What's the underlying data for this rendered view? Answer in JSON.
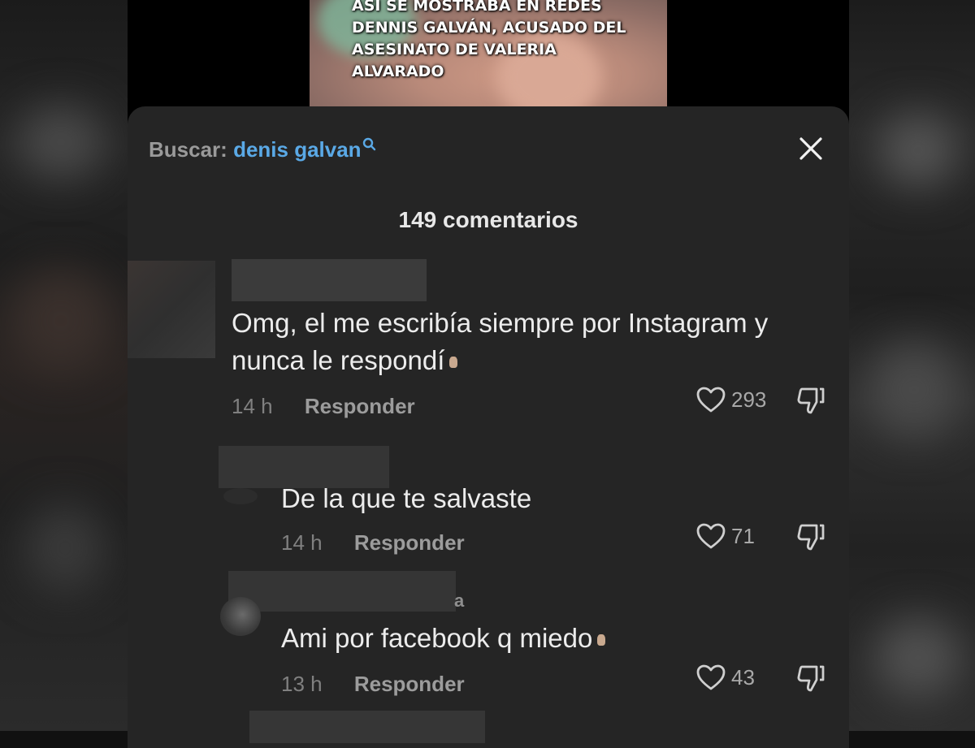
{
  "video": {
    "caption": "ASÍ SE MOSTRABA EN REDES DENNIS GALVÁN, ACUSADO DEL ASESINATO DE VALERIA ALVARADO"
  },
  "sheet": {
    "search_label": "Buscar:",
    "search_term": "denis galvan",
    "comment_count": "149 comentarios"
  },
  "comments": [
    {
      "text_line1": "Omg, el me escribía siempre por Instagram y",
      "text_line2": "nunca le respondí",
      "time": "14 h",
      "reply_label": "Responder",
      "likes": "293"
    },
    {
      "text": "De la que te salvaste",
      "time": "14 h",
      "reply_label": "Responder",
      "likes": "71"
    },
    {
      "name_suffix": "a",
      "text": "Ami por facebook q miedo",
      "time": "13 h",
      "reply_label": "Responder",
      "likes": "43"
    }
  ],
  "colors": {
    "sheet_bg": "#252525",
    "search_term": "#5aa9e6",
    "text_primary": "#ececec",
    "text_secondary": "#808080"
  },
  "icons": [
    "search-icon",
    "close-icon",
    "heart-icon",
    "dislike-icon"
  ]
}
